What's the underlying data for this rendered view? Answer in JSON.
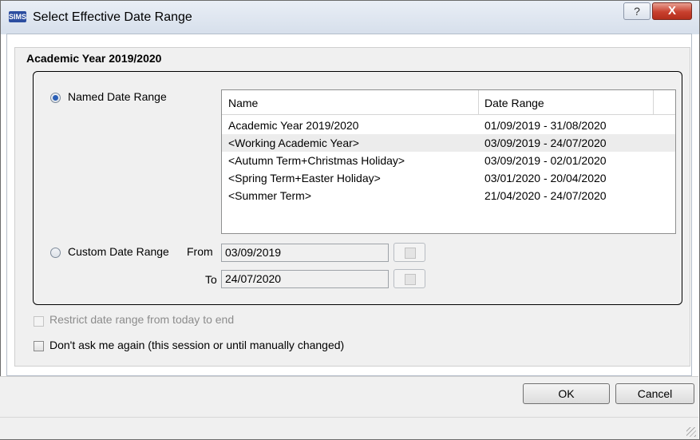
{
  "window": {
    "app_icon_text": "SIMS",
    "title": "Select Effective Date Range",
    "help_glyph": "?",
    "close_glyph": "X"
  },
  "section": {
    "title": "Academic Year 2019/2020"
  },
  "named_range": {
    "label": "Named Date Range",
    "selected": true,
    "columns": [
      "Name",
      "Date Range"
    ],
    "rows": [
      {
        "name": "Academic Year 2019/2020",
        "range": "01/09/2019 - 31/08/2020"
      },
      {
        "name": "<Working Academic Year>",
        "range": "03/09/2019 - 24/07/2020"
      },
      {
        "name": "<Autumn Term+Christmas Holiday>",
        "range": "03/09/2019 - 02/01/2020"
      },
      {
        "name": "<Spring Term+Easter Holiday>",
        "range": "03/01/2020 - 20/04/2020"
      },
      {
        "name": "<Summer Term>",
        "range": "21/04/2020 - 24/07/2020"
      }
    ],
    "selected_row": 1
  },
  "custom_range": {
    "label": "Custom Date Range",
    "selected": false,
    "from_label": "From",
    "from_value": "03/09/2019",
    "to_label": "To",
    "to_value": "24/07/2020"
  },
  "options": {
    "restrict_label": "Restrict date range from today to end",
    "restrict_checked": false,
    "restrict_enabled": false,
    "dont_ask_label": "Don't ask me again (this session or until manually changed)",
    "dont_ask_checked": false
  },
  "buttons": {
    "ok_label": "OK",
    "cancel_label": "Cancel"
  },
  "colors": {
    "radio_selected": "#2a5fb6",
    "close_button": "#c8402e"
  }
}
